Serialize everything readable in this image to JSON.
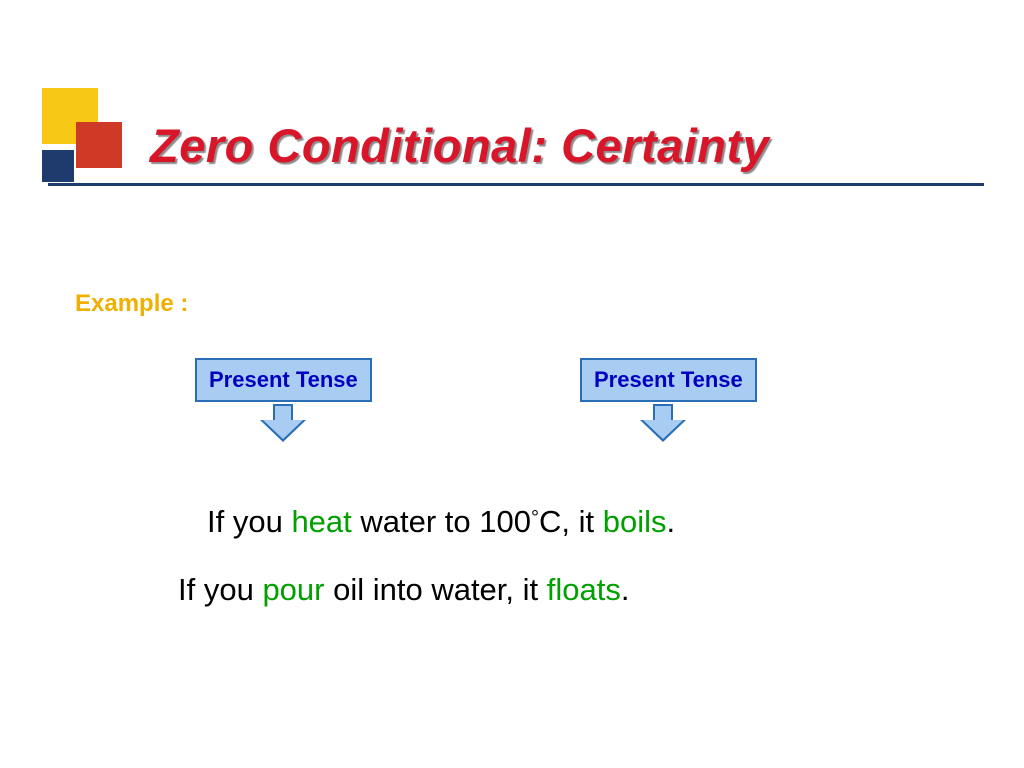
{
  "title": "Zero Conditional: Certainty",
  "example_label": "Example :",
  "boxes": {
    "left": "Present Tense",
    "right": "Present Tense"
  },
  "sentence1": {
    "p1": "If you ",
    "v1": "heat",
    "p2": " water to 100",
    "deg": "°",
    "p3": "C, it ",
    "v2": "boils",
    "p4": "."
  },
  "sentence2": {
    "p1": "If you ",
    "v1": "pour",
    "p2": " oil into water, it ",
    "v2": "floats",
    "p4": "."
  }
}
